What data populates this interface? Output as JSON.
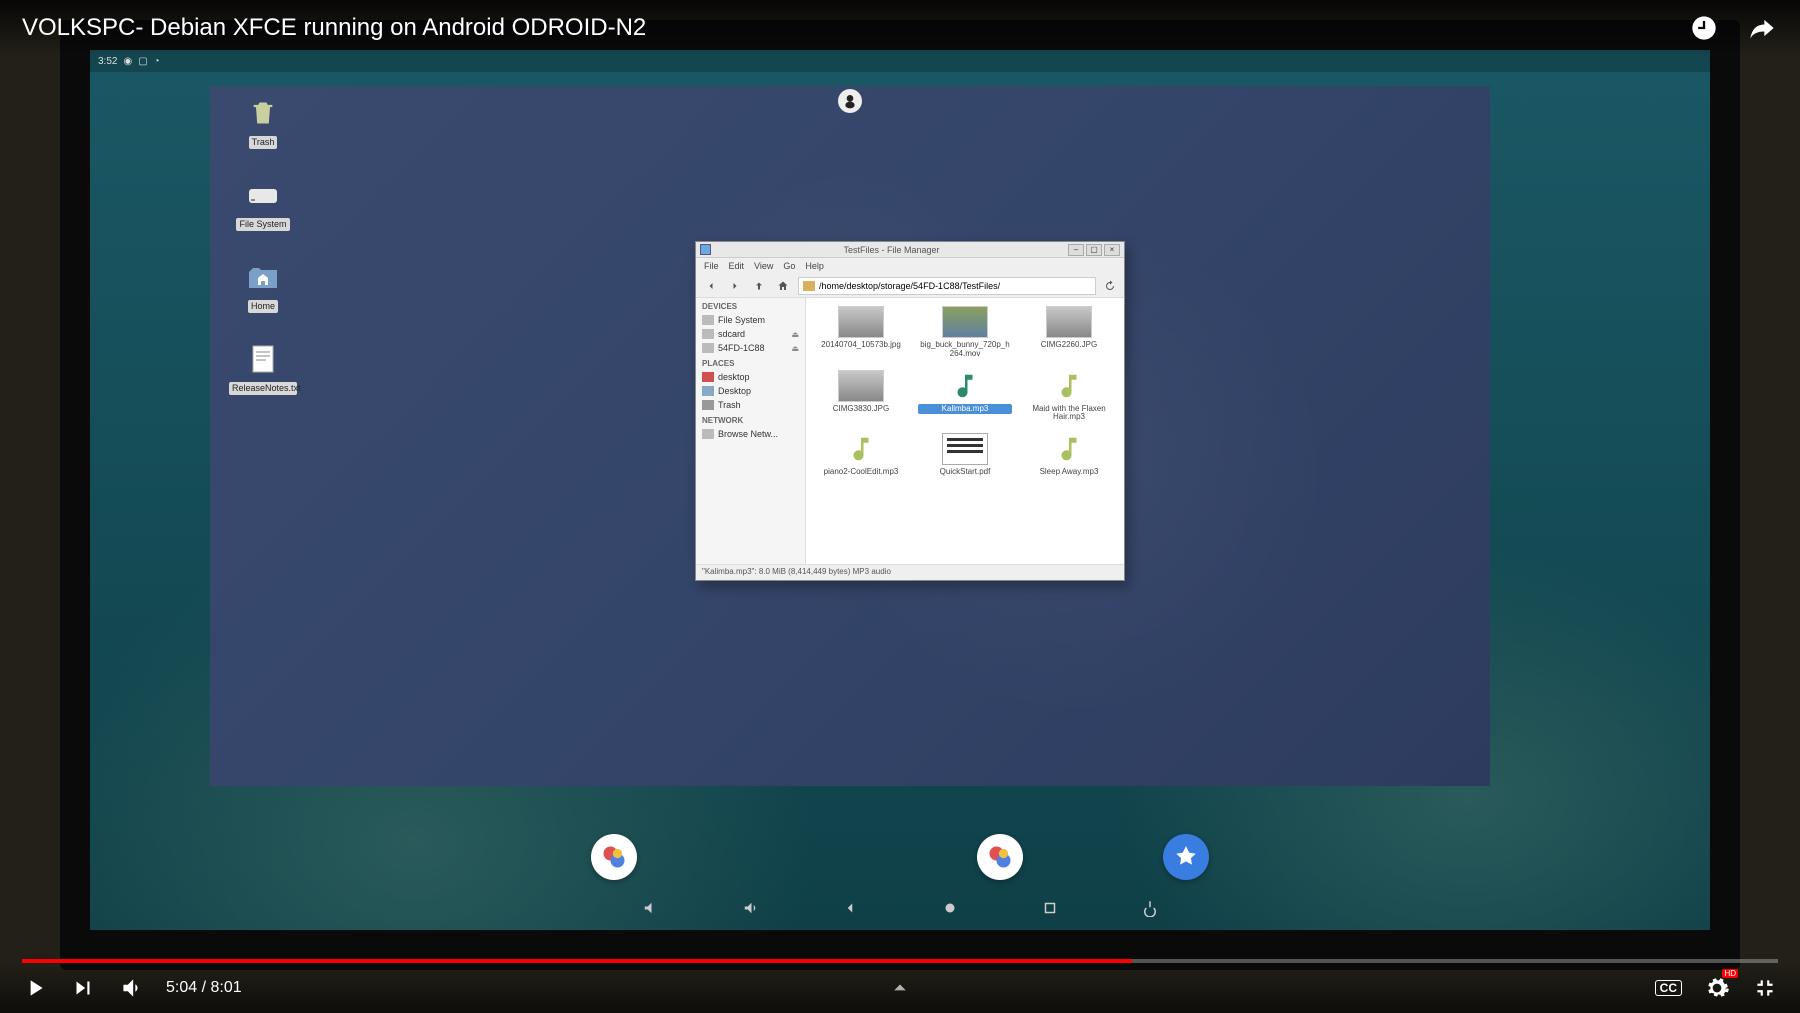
{
  "youtube": {
    "title": "VOLKSPC- Debian XFCE running on Android ODROID-N2",
    "current_time": "5:04",
    "duration": "8:01",
    "progress_pct": 63.2,
    "quality_badge": "HD",
    "cc_label": "CC"
  },
  "android_status": {
    "time": "3:52"
  },
  "xfce": {
    "desktop_icons": [
      {
        "name": "trash",
        "label": "Trash"
      },
      {
        "name": "file-system",
        "label": "File System"
      },
      {
        "name": "home",
        "label": "Home"
      },
      {
        "name": "release-notes",
        "label": "ReleaseNotes.txt"
      }
    ]
  },
  "file_manager": {
    "title": "TestFiles - File Manager",
    "menus": [
      "File",
      "Edit",
      "View",
      "Go",
      "Help"
    ],
    "path": "/home/desktop/storage/54FD-1C88/TestFiles/",
    "sidebar": {
      "devices_label": "DEVICES",
      "devices": [
        {
          "label": "File System",
          "eject": false
        },
        {
          "label": "sdcard",
          "eject": true
        },
        {
          "label": "54FD-1C88",
          "eject": true
        }
      ],
      "places_label": "PLACES",
      "places": [
        {
          "label": "desktop"
        },
        {
          "label": "Desktop"
        },
        {
          "label": "Trash"
        }
      ],
      "network_label": "NETWORK",
      "network": [
        {
          "label": "Browse Netw..."
        }
      ]
    },
    "files": [
      {
        "name": "20140704_10573b.jpg",
        "kind": "image"
      },
      {
        "name": "big_buck_bunny_720p_h264.mov",
        "kind": "video"
      },
      {
        "name": "CIMG2260.JPG",
        "kind": "image"
      },
      {
        "name": "CIMG3830.JPG",
        "kind": "image"
      },
      {
        "name": "Kalimba.mp3",
        "kind": "music",
        "selected": true
      },
      {
        "name": "Maid with the Flaxen Hair.mp3",
        "kind": "music"
      },
      {
        "name": "piano2-CoolEdit.mp3",
        "kind": "music"
      },
      {
        "name": "QuickStart.pdf",
        "kind": "doc"
      },
      {
        "name": "Sleep Away.mp3",
        "kind": "music"
      }
    ],
    "status": "\"Kalimba.mp3\": 8.0 MiB (8,414,449 bytes) MP3 audio"
  }
}
